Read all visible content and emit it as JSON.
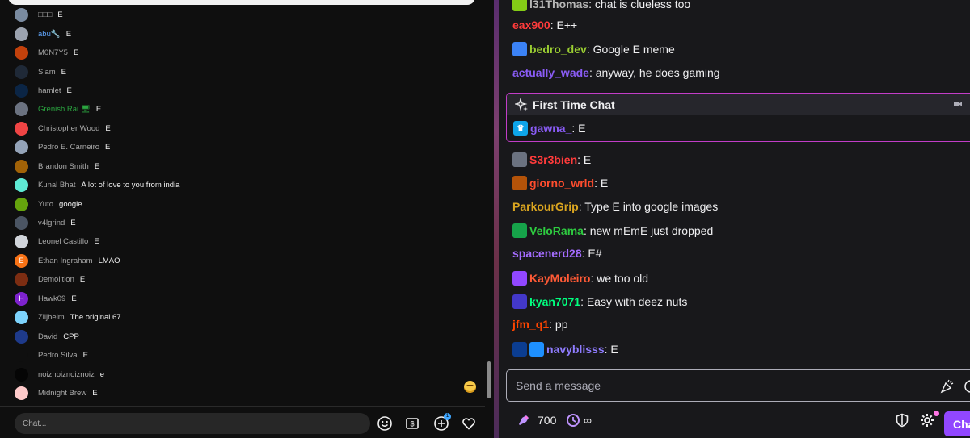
{
  "youtube_chat": {
    "messages": [
      {
        "name": "□□□",
        "msg": "E",
        "avatar_color": "#7a8ba0",
        "avatar_letter": ""
      },
      {
        "name": "abu🔧",
        "msg": "E",
        "avatar_color": "#9ca3af",
        "avatar_letter": "",
        "name_color": "#60a5fa"
      },
      {
        "name": "M0N7Y5",
        "msg": "E",
        "avatar_color": "#c2410c",
        "avatar_letter": ""
      },
      {
        "name": "Siam",
        "msg": "E",
        "avatar_color": "#1f2937",
        "avatar_letter": ""
      },
      {
        "name": "hamlet",
        "msg": "E",
        "avatar_color": "#0b2545",
        "avatar_letter": ""
      },
      {
        "name": "Grenish Rai 🖥",
        "msg": "E",
        "avatar_color": "#6b7280",
        "avatar_letter": "",
        "name_color": "#2ba640"
      },
      {
        "name": "Christopher Wood",
        "msg": "E",
        "avatar_color": "#ef4444",
        "avatar_letter": ""
      },
      {
        "name": "Pedro E. Carneiro",
        "msg": "E",
        "avatar_color": "#94a3b8",
        "avatar_letter": ""
      },
      {
        "name": "Brandon Smith",
        "msg": "E",
        "avatar_color": "#a16207",
        "avatar_letter": ""
      },
      {
        "name": "Kunal Bhat",
        "msg": "A lot of love to you from india",
        "avatar_color": "#5eead4",
        "avatar_letter": ""
      },
      {
        "name": "Yuto",
        "msg": "google",
        "avatar_color": "#65a30d",
        "avatar_letter": ""
      },
      {
        "name": "v4lgrind",
        "msg": "E",
        "avatar_color": "#4b5563",
        "avatar_letter": ""
      },
      {
        "name": "Leonel Castillo",
        "msg": "E",
        "avatar_color": "#d1d5db",
        "avatar_letter": ""
      },
      {
        "name": "Ethan Ingraham",
        "msg": "LMAO",
        "avatar_color": "#f97316",
        "avatar_letter": "E"
      },
      {
        "name": "Demolition",
        "msg": "E",
        "avatar_color": "#7c2d12",
        "avatar_letter": ""
      },
      {
        "name": "Hawk09",
        "msg": "E",
        "avatar_color": "#7e22ce",
        "avatar_letter": "H"
      },
      {
        "name": "Ziljheim",
        "msg": "The original 67",
        "avatar_color": "#7dd3fc",
        "avatar_letter": ""
      },
      {
        "name": "David",
        "msg": "CPP",
        "avatar_color": "#1e3a8a",
        "avatar_letter": ""
      },
      {
        "name": "Pedro Silva",
        "msg": "E",
        "avatar_color": "#0f0f0f",
        "avatar_letter": ""
      },
      {
        "name": "noiznoiznoiznoiz",
        "msg": "e",
        "avatar_color": "#050505",
        "avatar_letter": ""
      },
      {
        "name": "Midnight Brew",
        "msg": "E",
        "avatar_color": "#fecaca",
        "avatar_letter": ""
      }
    ],
    "input_placeholder": "Chat...",
    "notification_count": "1"
  },
  "twitch_chat": {
    "messages": [
      {
        "badges": [
          "#84cc16"
        ],
        "name": "l31Thomas",
        "color": "#b6b6b6",
        "text": ": chat is clueless too"
      },
      {
        "badges": [],
        "name": "eax900",
        "color": "#ff3b3b",
        "text": ": E++"
      },
      {
        "badges": [
          "#3b82f6"
        ],
        "name": "bedro_dev",
        "color": "#9acd32",
        "text": ": Google E meme"
      },
      {
        "badges": [],
        "name": "actually_wade",
        "color": "#8a5cf6",
        "text": ": anyway, he does gaming"
      }
    ],
    "first_time": {
      "title": "First Time Chat",
      "name": "gawna_",
      "color": "#8a5cf6",
      "text": ": E"
    },
    "messages_after": [
      {
        "badges": [
          "#6b7280"
        ],
        "name": "S3r3bien",
        "color": "#ff3b3b",
        "text": ": E"
      },
      {
        "badges": [
          "#b45309"
        ],
        "name": "giorno_wrld",
        "color": "#ff4d2e",
        "text": ": E"
      },
      {
        "badges": [],
        "name": "ParkourGrip",
        "color": "#daa520",
        "text": ": Type E into google images"
      },
      {
        "badges": [
          "#16a34a"
        ],
        "name": "VeloRama",
        "color": "#2ecc40",
        "text": ": new mEmE just dropped"
      },
      {
        "badges": [],
        "name": "spacenerd28",
        "color": "#a46cff",
        "text": ": E#"
      },
      {
        "badges": [
          "#9147ff"
        ],
        "name": "KayMoleiro",
        "color": "#ff5a36",
        "text": ": we too old"
      },
      {
        "badges": [
          "#4338ca"
        ],
        "name": "kyan7071",
        "color": "#00ff7f",
        "text": ": Easy with deez nuts"
      },
      {
        "badges": [],
        "name": "jfm_q1",
        "color": "#ff4500",
        "text": ": pp"
      },
      {
        "badges": [
          "#0b3d91",
          "#1e90ff"
        ],
        "name": "navyblisss",
        "color": "#8f7cff",
        "text": ": E"
      }
    ],
    "input_placeholder": "Send a message",
    "points": "700",
    "infinity": "∞",
    "chat_button": "Chat"
  }
}
